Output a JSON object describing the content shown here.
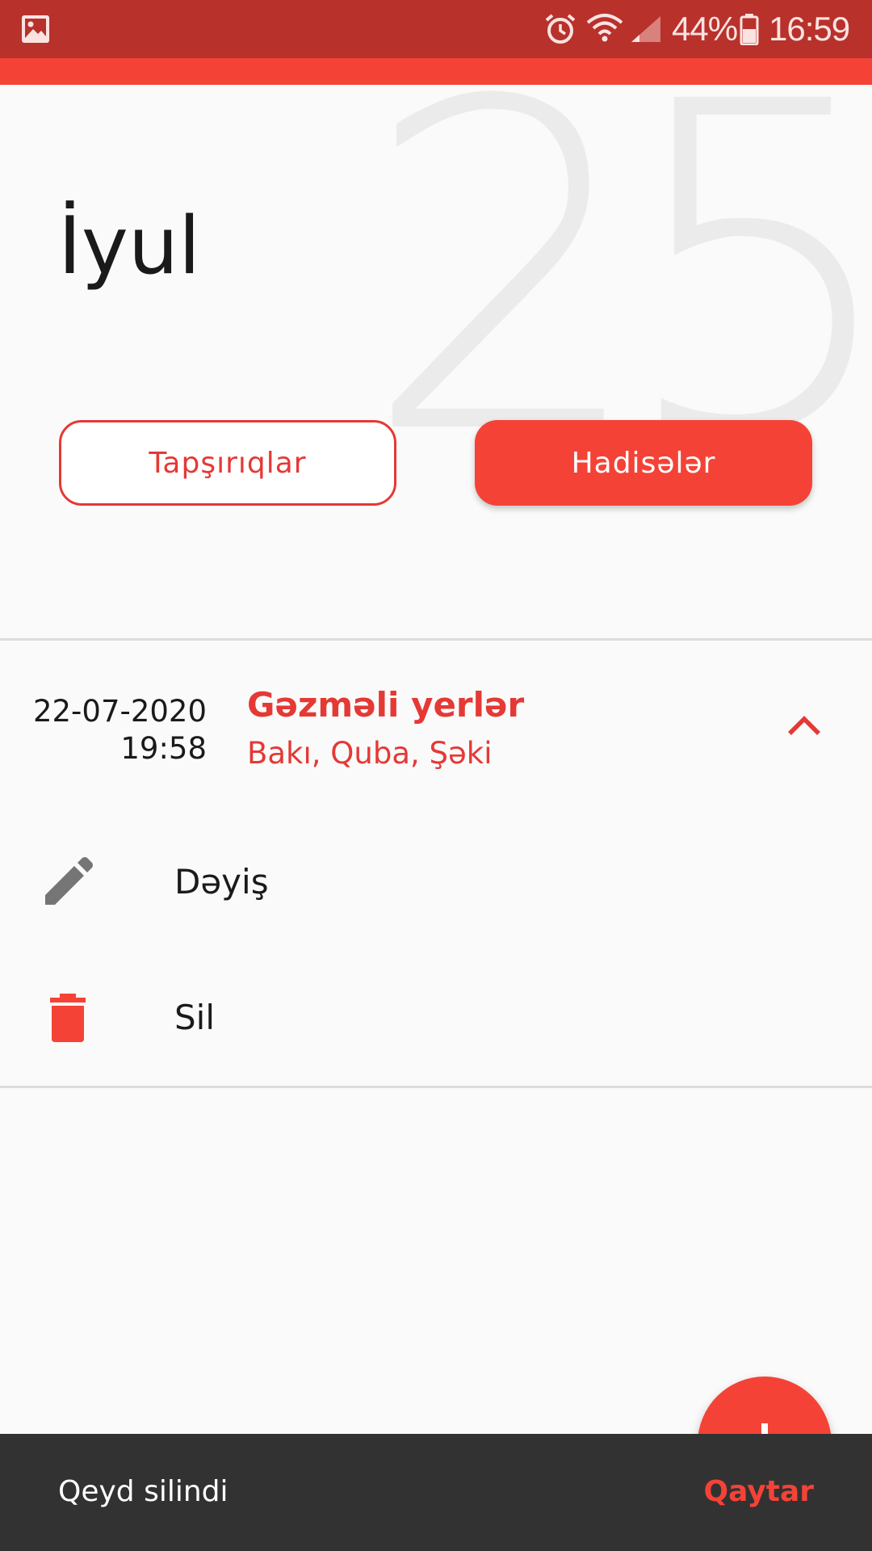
{
  "status_bar": {
    "battery": "44%",
    "time": "16:59",
    "icons": [
      "gallery-icon",
      "alarm-icon",
      "wifi-icon",
      "signal-icon",
      "battery-icon"
    ]
  },
  "header": {
    "day": "25",
    "month": "İyul"
  },
  "segments": {
    "tasks_label": "Tapşırıqlar",
    "events_label": "Hadisələr",
    "selected": "events"
  },
  "event": {
    "date": "22-07-2020",
    "time": "19:58",
    "title": "Gəzməli yerlər",
    "subtitle": "Bakı, Quba, Şəki",
    "expanded": true
  },
  "actions": {
    "edit_label": "Dəyiş",
    "delete_label": "Sil"
  },
  "snackbar": {
    "message": "Qeyd silindi",
    "action_label": "Qaytar"
  },
  "colors": {
    "status_bar": "#b8312b",
    "accent": "#f44336",
    "snackbar": "#323232"
  }
}
